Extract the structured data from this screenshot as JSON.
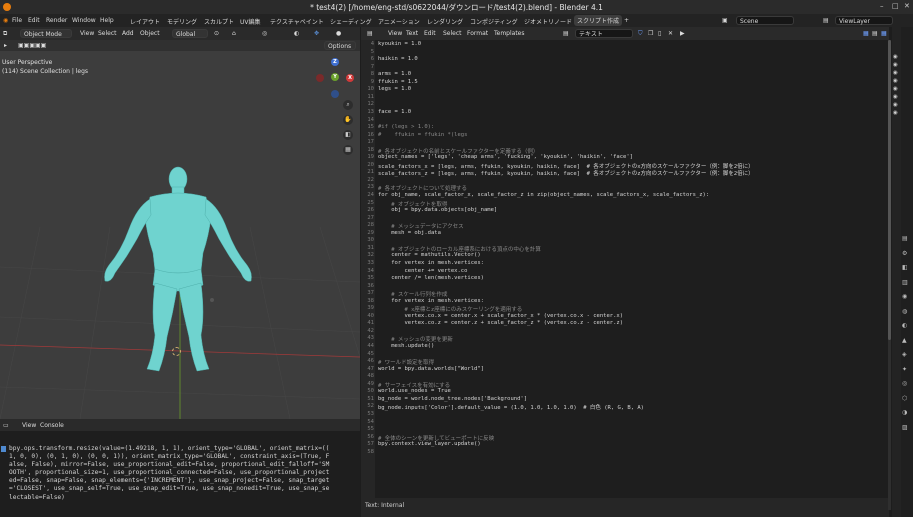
{
  "window": {
    "title": "* test4(2) [/home/eng-std/s0622044/ダウンロード/test4(2).blend] - Blender 4.1"
  },
  "menu": {
    "items": [
      "File",
      "Edit",
      "Render",
      "Window",
      "Help"
    ],
    "workspaces": [
      "レイアウト",
      "モデリング",
      "スカルプト",
      "UV編集",
      "テクスチャペイント",
      "シェーディング",
      "アニメーション",
      "レンダリング",
      "コンポジティング",
      "ジオメトリノード",
      "スクリプト作成"
    ],
    "add_tab": "+",
    "scene": "Scene",
    "view_layer": "ViewLayer"
  },
  "viewport": {
    "mode": "Object Mode",
    "menus": [
      "View",
      "Select",
      "Add",
      "Object"
    ],
    "transform": "Global",
    "options": "Options",
    "perspective": "User Perspective",
    "collection": "(114) Scene Collection | legs",
    "axes": {
      "z": "Z",
      "y": "Y",
      "x": "X"
    },
    "colors": {
      "body": "#6fd3cf",
      "grid_red": "#a23a3a",
      "grid_green": "#6a9a2a"
    }
  },
  "console": {
    "menus": [
      "View",
      "Console"
    ],
    "output": "bpy.ops.transform.resize(value=(1.49218, 1, 1), orient_type='GLOBAL', orient_matrix=((\n1, 0, 0), (0, 1, 0), (0, 0, 1)), orient_matrix_type='GLOBAL', constraint_axis=(True, F\nalse, False), mirror=False, use_proportional_edit=False, proportional_edit_falloff='SM\nOOTH', proportional_size=1, use_proportional_connected=False, use_proportional_project\ned=False, snap=False, snap_elements={'INCREMENT'}, use_snap_project=False, snap_target\n='CLOSEST', use_snap_self=True, use_snap_edit=True, use_snap_nonedit=True, use_snap_se\nlectable=False)"
  },
  "editor": {
    "menus": [
      "View",
      "Text",
      "Edit",
      "Select",
      "Format",
      "Templates"
    ],
    "text_name": "テキスト",
    "footer": "Text: Internal",
    "lines": [
      {
        "n": "4",
        "t": "kyoukin = 1.0"
      },
      {
        "n": "5",
        "t": ""
      },
      {
        "n": "6",
        "t": "haikin = 1.0"
      },
      {
        "n": "7",
        "t": ""
      },
      {
        "n": "8",
        "t": "arms = 1.0"
      },
      {
        "n": "9",
        "t": "ffukin = 1.5"
      },
      {
        "n": "10",
        "t": "legs = 1.0"
      },
      {
        "n": "11",
        "t": ""
      },
      {
        "n": "12",
        "t": ""
      },
      {
        "n": "13",
        "t": "face = 1.0"
      },
      {
        "n": "14",
        "t": ""
      },
      {
        "n": "15",
        "t": "#if (legs > 1.0):"
      },
      {
        "n": "16",
        "t": "#    ffukin = ffukin *(legs"
      },
      {
        "n": "17",
        "t": ""
      },
      {
        "n": "18",
        "t": "# 各オブジェクトの名前とスケールファクターを定義する（例）"
      },
      {
        "n": "19",
        "t": "object_names = ['legs', 'cheap arms', 'fucking', 'kyoukin', 'haikin', 'face']"
      },
      {
        "n": "20",
        "t": "scale_factors_x = [legs, arms, ffukin, kyoukin, haikin, face]  # 各オブジェクトのx方向のスケールファクター（例：脚を2倍に）"
      },
      {
        "n": "21",
        "t": "scale_factors_z = [legs, arms, ffukin, kyoukin, haikin, face]  # 各オブジェクトのz方向のスケールファクター（例：脚を2倍に）"
      },
      {
        "n": "22",
        "t": ""
      },
      {
        "n": "23",
        "t": "# 各オブジェクトについて処理する"
      },
      {
        "n": "24",
        "t": "for obj_name, scale_factor_x, scale_factor_z in zip(object_names, scale_factors_x, scale_factors_z):"
      },
      {
        "n": "25",
        "t": "    # オブジェクトを取得"
      },
      {
        "n": "26",
        "t": "    obj = bpy.data.objects[obj_name]"
      },
      {
        "n": "27",
        "t": ""
      },
      {
        "n": "28",
        "t": "    # メッシュデータにアクセス"
      },
      {
        "n": "29",
        "t": "    mesh = obj.data"
      },
      {
        "n": "30",
        "t": ""
      },
      {
        "n": "31",
        "t": "    # オブジェクトのローカル座標系における頂点の中心を計算"
      },
      {
        "n": "32",
        "t": "    center = mathutils.Vector()"
      },
      {
        "n": "33",
        "t": "    for vertex in mesh.vertices:"
      },
      {
        "n": "34",
        "t": "        center += vertex.co"
      },
      {
        "n": "35",
        "t": "    center /= len(mesh.vertices)"
      },
      {
        "n": "36",
        "t": ""
      },
      {
        "n": "37",
        "t": "    # スケール行列を作成"
      },
      {
        "n": "38",
        "t": "    for vertex in mesh.vertices:"
      },
      {
        "n": "39",
        "t": "        # x座標とz座標にのみスケーリングを適用する"
      },
      {
        "n": "40",
        "t": "        vertex.co.x = center.x + scale_factor_x * (vertex.co.x - center.x)"
      },
      {
        "n": "41",
        "t": "        vertex.co.z = center.z + scale_factor_z * (vertex.co.z - center.z)"
      },
      {
        "n": "42",
        "t": ""
      },
      {
        "n": "43",
        "t": "    # メッシュの変更を更新"
      },
      {
        "n": "44",
        "t": "    mesh.update()"
      },
      {
        "n": "45",
        "t": ""
      },
      {
        "n": "46",
        "t": "# ワールド設定を取得"
      },
      {
        "n": "47",
        "t": "world = bpy.data.worlds[\"World\"]"
      },
      {
        "n": "48",
        "t": ""
      },
      {
        "n": "49",
        "t": "# サーフェイスを有効にする"
      },
      {
        "n": "50",
        "t": "world.use_nodes = True"
      },
      {
        "n": "51",
        "t": "bg_node = world.node_tree.nodes['Background']"
      },
      {
        "n": "52",
        "t": "bg_node.inputs['Color'].default_value = (1.0, 1.0, 1.0, 1.0)  # 白色 (R, G, B, A)"
      },
      {
        "n": "53",
        "t": ""
      },
      {
        "n": "54",
        "t": ""
      },
      {
        "n": "55",
        "t": ""
      },
      {
        "n": "56",
        "t": "# 全体のシーンを更新してビューポートに反映"
      },
      {
        "n": "57",
        "t": "bpy.context.view_layer.update()"
      },
      {
        "n": "58",
        "t": ""
      }
    ]
  }
}
